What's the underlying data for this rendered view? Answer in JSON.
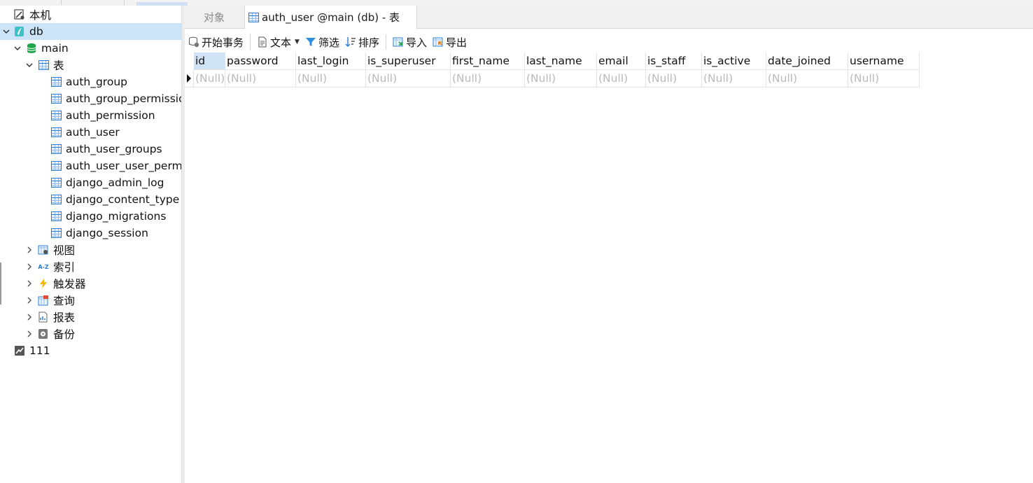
{
  "sidebar": {
    "items": [
      {
        "label": "本机",
        "icon": "pc-connection-icon"
      },
      {
        "label": "db",
        "icon": "sqlite-connection-icon"
      },
      {
        "label": "main",
        "icon": "database-icon"
      },
      {
        "label": "表",
        "icon": "table-folder-icon"
      },
      {
        "label": "auth_group",
        "icon": "table-icon"
      },
      {
        "label": "auth_group_permissions",
        "icon": "table-icon"
      },
      {
        "label": "auth_permission",
        "icon": "table-icon"
      },
      {
        "label": "auth_user",
        "icon": "table-icon"
      },
      {
        "label": "auth_user_groups",
        "icon": "table-icon"
      },
      {
        "label": "auth_user_user_permissions",
        "icon": "table-icon"
      },
      {
        "label": "django_admin_log",
        "icon": "table-icon"
      },
      {
        "label": "django_content_type",
        "icon": "table-icon"
      },
      {
        "label": "django_migrations",
        "icon": "table-icon"
      },
      {
        "label": "django_session",
        "icon": "table-icon"
      },
      {
        "label": "视图",
        "icon": "view-icon"
      },
      {
        "label": "索引",
        "icon": "index-icon"
      },
      {
        "label": "触发器",
        "icon": "trigger-icon"
      },
      {
        "label": "查询",
        "icon": "query-icon"
      },
      {
        "label": "报表",
        "icon": "report-icon"
      },
      {
        "label": "备份",
        "icon": "backup-icon"
      },
      {
        "label": "111",
        "icon": "connection-icon"
      }
    ]
  },
  "tabs": {
    "objects_label": "对象",
    "active_label": "auth_user @main (db) - 表"
  },
  "toolbar": {
    "begin_transaction": "开始事务",
    "text": "文本",
    "filter": "筛选",
    "sort": "排序",
    "import": "导入",
    "export": "导出"
  },
  "grid": {
    "columns": [
      "id",
      "password",
      "last_login",
      "is_superuser",
      "first_name",
      "last_name",
      "email",
      "is_staff",
      "is_active",
      "date_joined",
      "username"
    ],
    "rows": [
      [
        "(Null)",
        "(Null)",
        "(Null)",
        "(Null)",
        "(Null)",
        "(Null)",
        "(Null)",
        "(Null)",
        "(Null)",
        "(Null)",
        "(Null)"
      ]
    ]
  },
  "colors": {
    "selection": "#cce4f7",
    "header_selected": "#cfe3f5",
    "null_text": "#b9b9b9",
    "accent": "#2b7cd3"
  }
}
